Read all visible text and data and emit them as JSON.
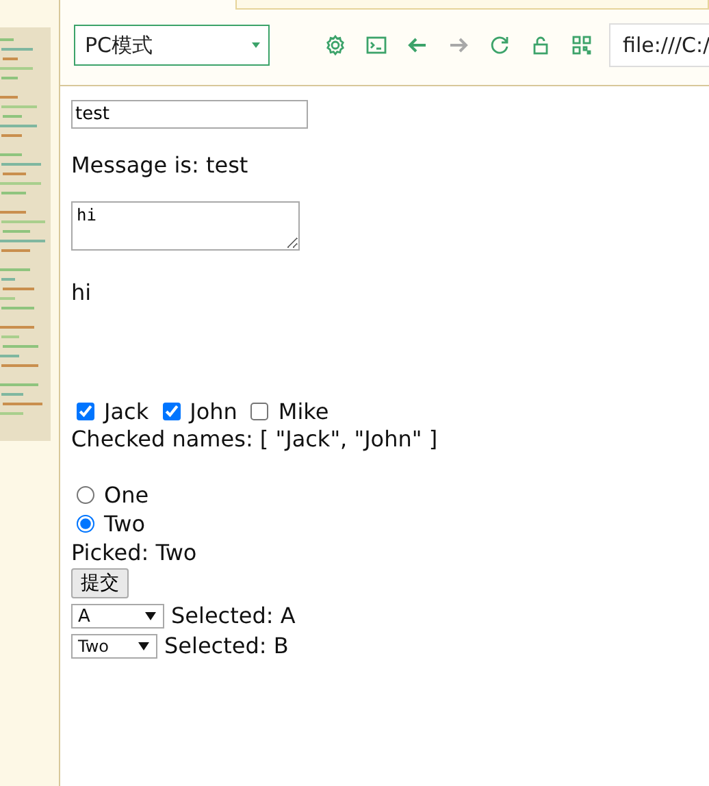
{
  "toolbar": {
    "mode_select": "PC模式",
    "buttons": [
      {
        "kind": "settings",
        "disabled": false
      },
      {
        "kind": "console",
        "disabled": false
      },
      {
        "kind": "back",
        "disabled": false
      },
      {
        "kind": "forward",
        "disabled": true
      },
      {
        "kind": "reload",
        "disabled": false
      },
      {
        "kind": "lock",
        "disabled": false
      },
      {
        "kind": "qr",
        "disabled": false
      }
    ],
    "address": "file:///C:/"
  },
  "content": {
    "message_input": "test",
    "message_text": "Message is: test",
    "textarea": "hi",
    "textarea_echo": "hi",
    "checkboxes": [
      {
        "label": "Jack",
        "checked": true
      },
      {
        "label": "John",
        "checked": true
      },
      {
        "label": "Mike",
        "checked": false
      }
    ],
    "checked_text": "Checked names: [ \"Jack\", \"John\" ]",
    "radios": [
      {
        "label": "One",
        "selected": false
      },
      {
        "label": "Two",
        "selected": true
      }
    ],
    "picked_text": "Picked: Two",
    "submit_button": "提交",
    "selects": [
      {
        "value": "A",
        "text": "Selected: A"
      },
      {
        "value": "Two",
        "text": "Selected: B"
      }
    ]
  }
}
